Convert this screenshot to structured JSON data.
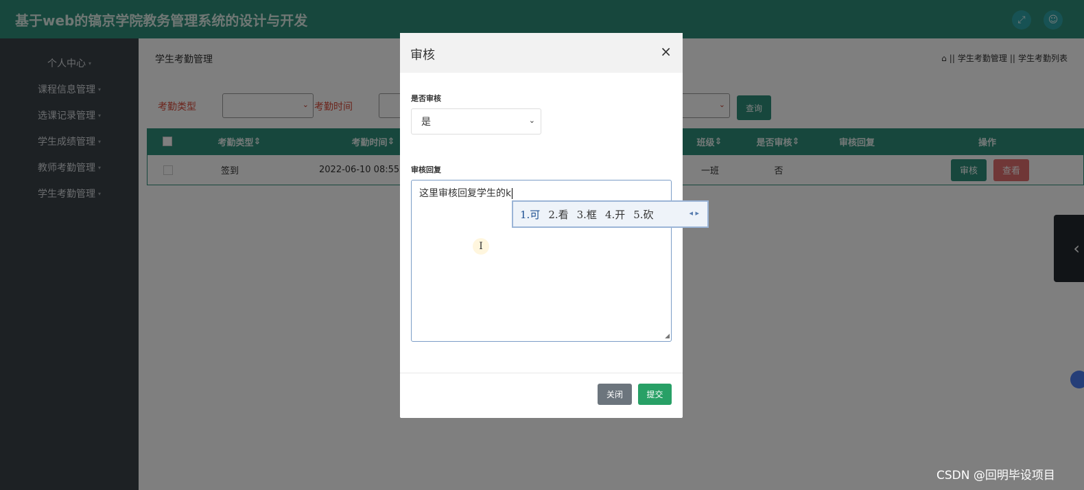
{
  "header": {
    "title": "基于web的镐京学院教务管理系统的设计与开发",
    "fullscreen_icon": "expand-icon",
    "user_icon": "user-icon"
  },
  "sidebar": {
    "items": [
      {
        "label": "个人中心"
      },
      {
        "label": "课程信息管理"
      },
      {
        "label": "选课记录管理"
      },
      {
        "label": "学生成绩管理"
      },
      {
        "label": "教师考勤管理"
      },
      {
        "label": "学生考勤管理"
      }
    ]
  },
  "main": {
    "page_title": "学生考勤管理",
    "breadcrumb": [
      "学生考勤管理",
      "学生考勤列表"
    ],
    "search": {
      "type_label": "考勤类型",
      "time_label": "考勤时间",
      "query_label": "查询"
    },
    "table": {
      "columns": [
        "考勤类型",
        "考勤时间",
        "班级",
        "是否审核",
        "审核回复",
        "操作"
      ],
      "rows": [
        {
          "type": "签到",
          "time": "2022-06-10 08:55",
          "class": "一班",
          "reviewed": "否",
          "reply": ""
        }
      ],
      "audit_label": "审核",
      "view_label": "查看"
    }
  },
  "modal": {
    "title": "审核",
    "close_symbol": "×",
    "review_label": "是否审核",
    "review_value": "是",
    "reply_label": "审核回复",
    "reply_value": "这里审核回复学生的k",
    "close_button": "关闭",
    "submit_button": "提交"
  },
  "ime": {
    "candidates": [
      "1.可",
      "2.看",
      "3.框",
      "4.开",
      "5.砍"
    ]
  },
  "watermark": "CSDN @回明毕设项目",
  "colors": {
    "primary": "#2f8f7b",
    "sidebar": "#3a4249",
    "danger": "#e06f6f",
    "submit": "#28a066"
  }
}
